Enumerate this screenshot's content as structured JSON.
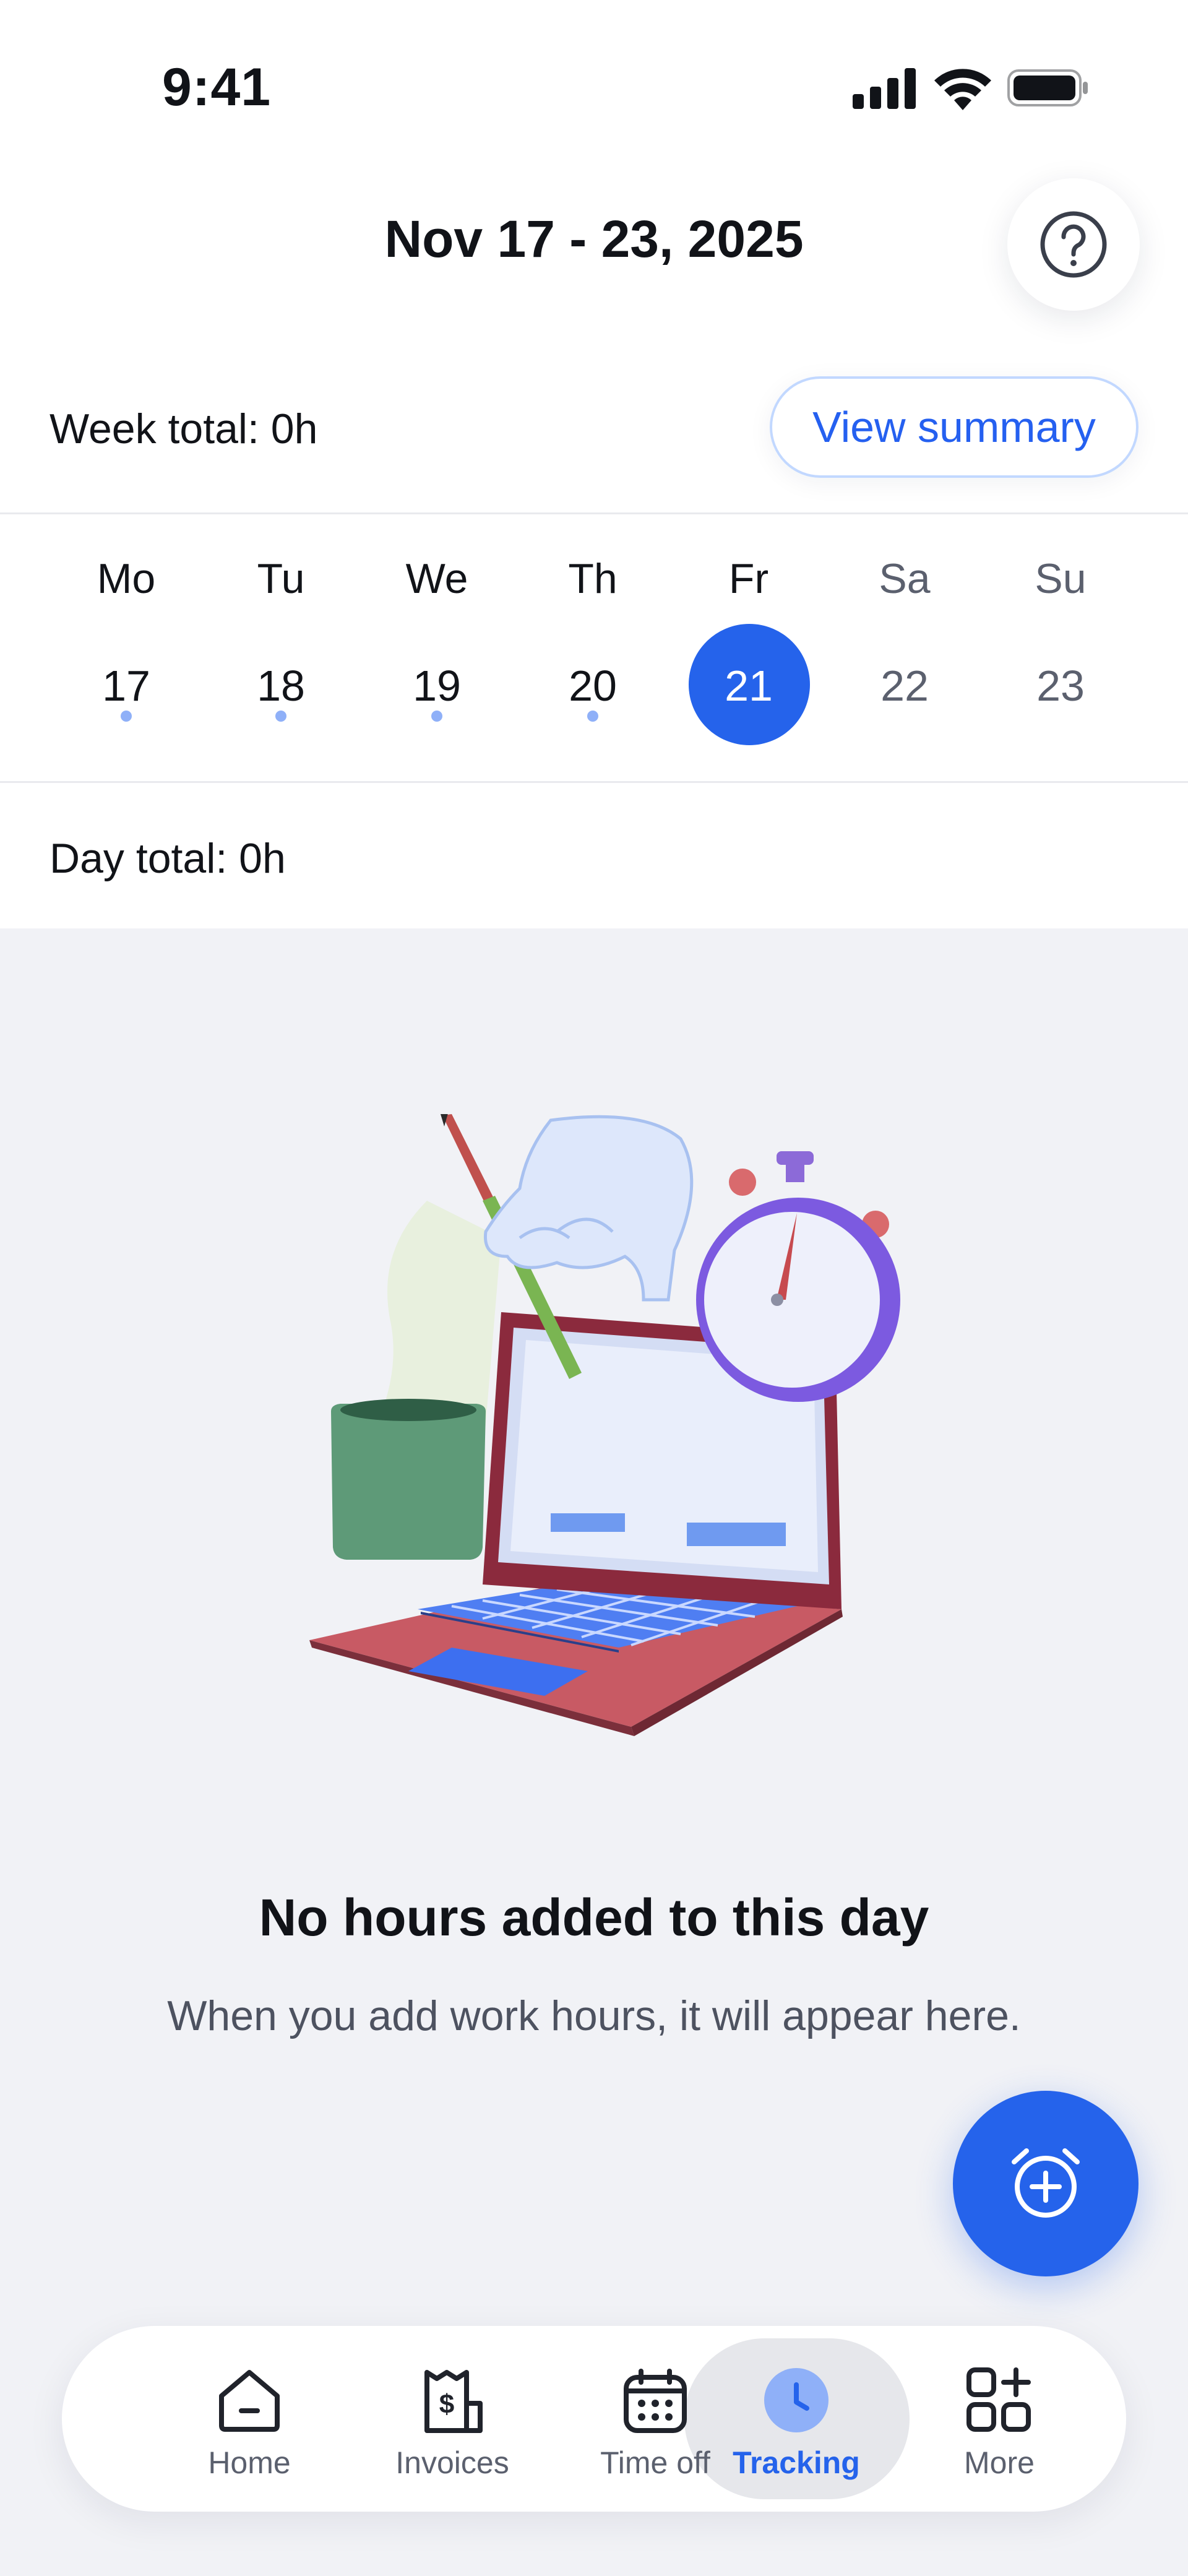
{
  "status_bar": {
    "time": "9:41"
  },
  "header": {
    "week_range": "Nov 17 - 23, 2025",
    "week_total": "Week total: 0h",
    "view_summary_label": "View summary"
  },
  "calendar": {
    "days": [
      {
        "dow": "Mo",
        "date": "17",
        "has_dot": true
      },
      {
        "dow": "Tu",
        "date": "18",
        "has_dot": true
      },
      {
        "dow": "We",
        "date": "19",
        "has_dot": true
      },
      {
        "dow": "Th",
        "date": "20",
        "has_dot": true
      },
      {
        "dow": "Fr",
        "date": "21",
        "selected": true
      },
      {
        "dow": "Sa",
        "date": "22"
      },
      {
        "dow": "Su",
        "date": "23"
      }
    ]
  },
  "day_total": "Day total: 0h",
  "empty_state": {
    "title": "No hours added to this day",
    "subtitle": "When you add work hours, it will appear here."
  },
  "bottom_nav": {
    "items": [
      {
        "label": "Home",
        "icon": "home-icon"
      },
      {
        "label": "Invoices",
        "icon": "invoice-icon"
      },
      {
        "label": "Time off",
        "icon": "calendar-icon"
      },
      {
        "label": "Tracking",
        "icon": "clock-icon",
        "active": true
      },
      {
        "label": "More",
        "icon": "grid-plus-icon"
      }
    ]
  },
  "colors": {
    "accent": "#2563eb",
    "background": "#f1f2f6",
    "dot": "#8fb0f8"
  }
}
